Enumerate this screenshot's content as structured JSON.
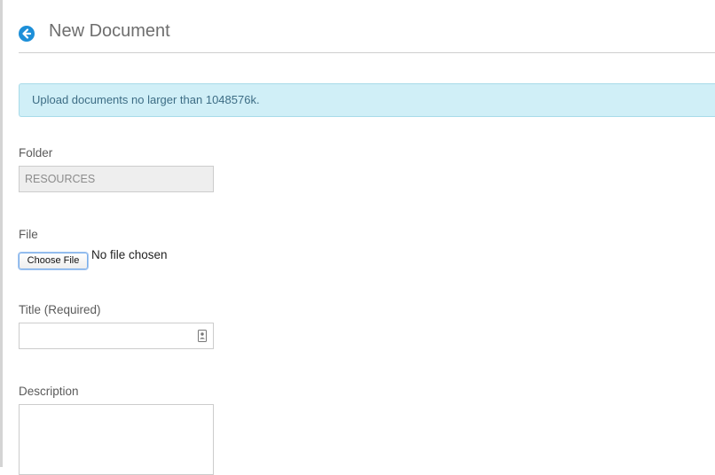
{
  "header": {
    "title": "New Document"
  },
  "alert": {
    "message": "Upload documents no larger than 1048576k."
  },
  "form": {
    "folder": {
      "label": "Folder",
      "value": "RESOURCES"
    },
    "file": {
      "label": "File",
      "button_label": "Choose File",
      "status": "No file chosen"
    },
    "title": {
      "label": "Title (Required)",
      "value": ""
    },
    "description": {
      "label": "Description",
      "value": ""
    }
  },
  "colors": {
    "accent": "#1d8fd8",
    "alert_bg": "#d0eff7",
    "alert_text": "#3d6d85"
  },
  "icons": {
    "back": "arrow-left-circle-icon",
    "autofill": "contact-card-icon"
  }
}
